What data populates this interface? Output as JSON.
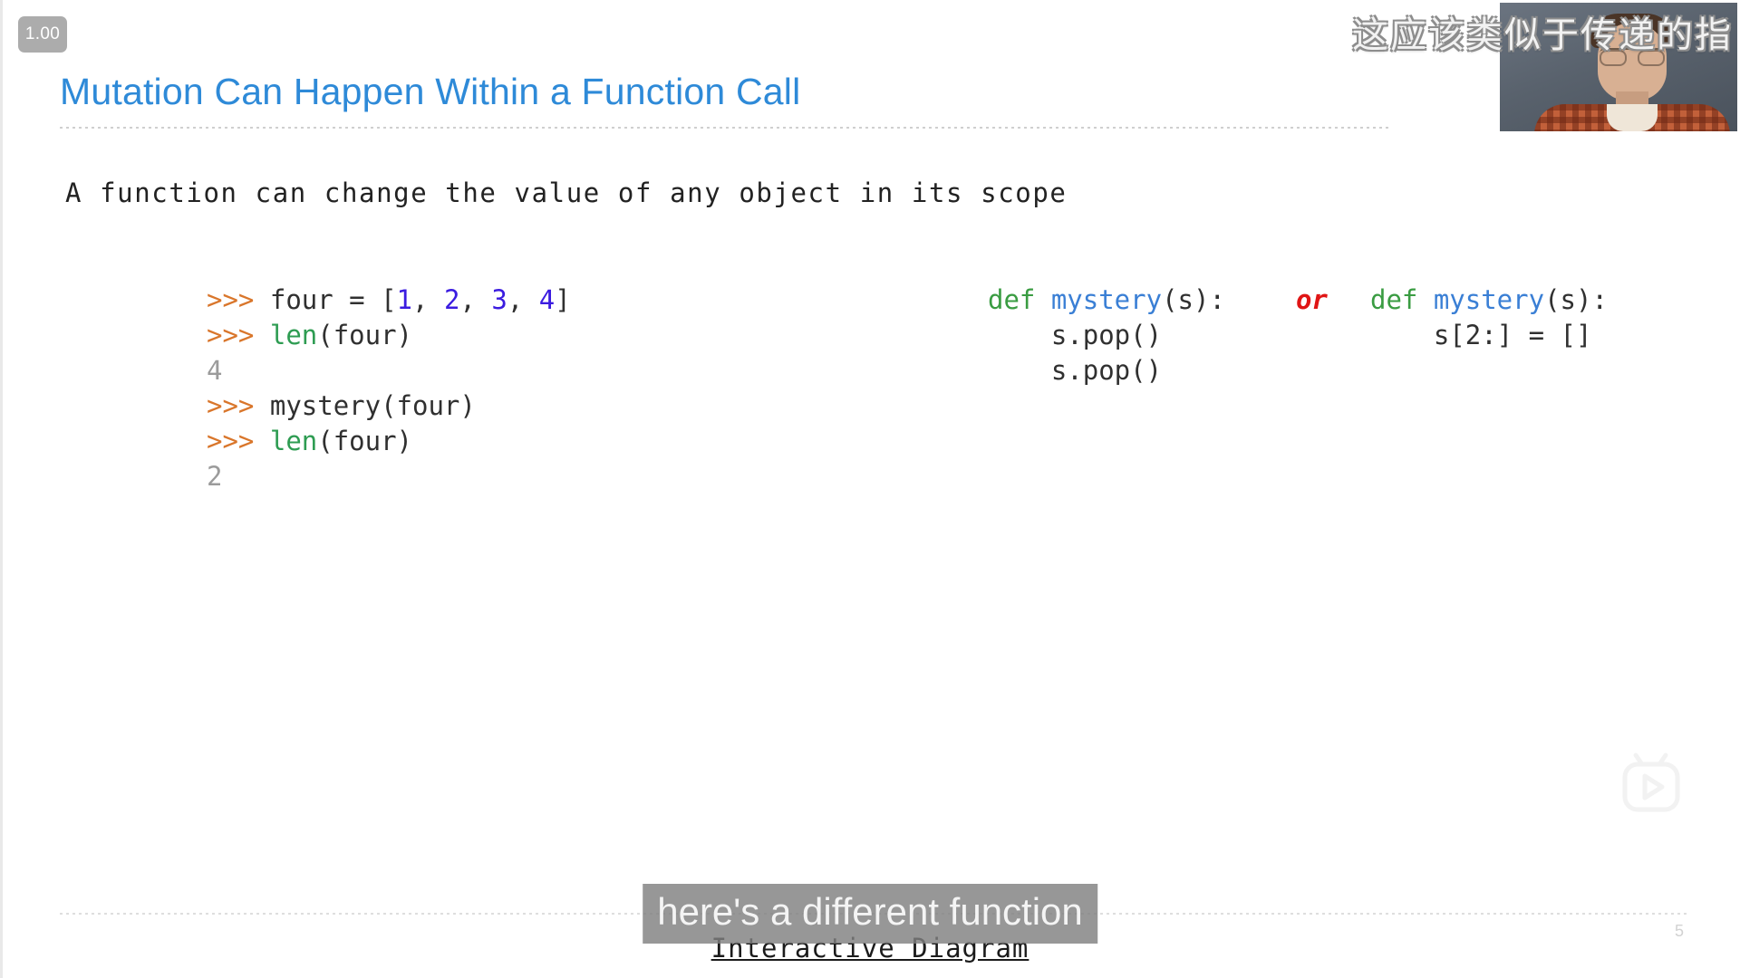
{
  "player": {
    "rate_badge": "1.00",
    "watermark_icon": "tv-play-icon"
  },
  "slide": {
    "title": "Mutation Can Happen Within a Function Call",
    "body_text": "A function can change the value of any object in its scope",
    "page_number": "5",
    "interactive_diagram_link": "Interactive Diagram",
    "title_color": "#2e8ad8"
  },
  "repl": {
    "lines": [
      {
        "prompt": ">>>",
        "tokens": [
          {
            "text": "four = ",
            "kind": "plain"
          },
          {
            "text": "[",
            "kind": "plain"
          },
          {
            "text": "1",
            "kind": "num"
          },
          {
            "text": ", ",
            "kind": "plain"
          },
          {
            "text": "2",
            "kind": "num"
          },
          {
            "text": ", ",
            "kind": "plain"
          },
          {
            "text": "3",
            "kind": "num"
          },
          {
            "text": ", ",
            "kind": "plain"
          },
          {
            "text": "4",
            "kind": "num"
          },
          {
            "text": "]",
            "kind": "plain"
          }
        ]
      },
      {
        "prompt": ">>>",
        "tokens": [
          {
            "text": "len",
            "kind": "builtin"
          },
          {
            "text": "(four)",
            "kind": "plain"
          }
        ]
      },
      {
        "prompt": "",
        "tokens": [
          {
            "text": "4",
            "kind": "out"
          }
        ]
      },
      {
        "prompt": ">>>",
        "tokens": [
          {
            "text": "mystery(four)",
            "kind": "plain"
          }
        ]
      },
      {
        "prompt": ">>>",
        "tokens": [
          {
            "text": "len",
            "kind": "builtin"
          },
          {
            "text": "(four)",
            "kind": "plain"
          }
        ]
      },
      {
        "prompt": "",
        "tokens": [
          {
            "text": "2",
            "kind": "out"
          }
        ]
      }
    ]
  },
  "definition_a": {
    "line1": [
      {
        "text": "def ",
        "kind": "kw"
      },
      {
        "text": "mystery",
        "kind": "fname"
      },
      {
        "text": "(s):",
        "kind": "plain"
      }
    ],
    "line2": "    s.pop()",
    "line3": "    s.pop()"
  },
  "or_separator": "or",
  "definition_b": {
    "line1": [
      {
        "text": "def ",
        "kind": "kw"
      },
      {
        "text": "mystery",
        "kind": "fname"
      },
      {
        "text": "(s):",
        "kind": "plain"
      }
    ],
    "line2": "    s[2:] = []"
  },
  "captions": {
    "chinese_overlay": "这应该类似于传递的指",
    "english_caption": "here's a different function"
  },
  "colors": {
    "prompt": "#d9762b",
    "number_literal": "#3b1ce0",
    "builtin": "#2e9c52",
    "keyword": "#3a9c42",
    "function_name": "#3a7fd5",
    "or_keyword": "#e01515",
    "output": "#9b9b9b",
    "caption_background": "#808080"
  }
}
